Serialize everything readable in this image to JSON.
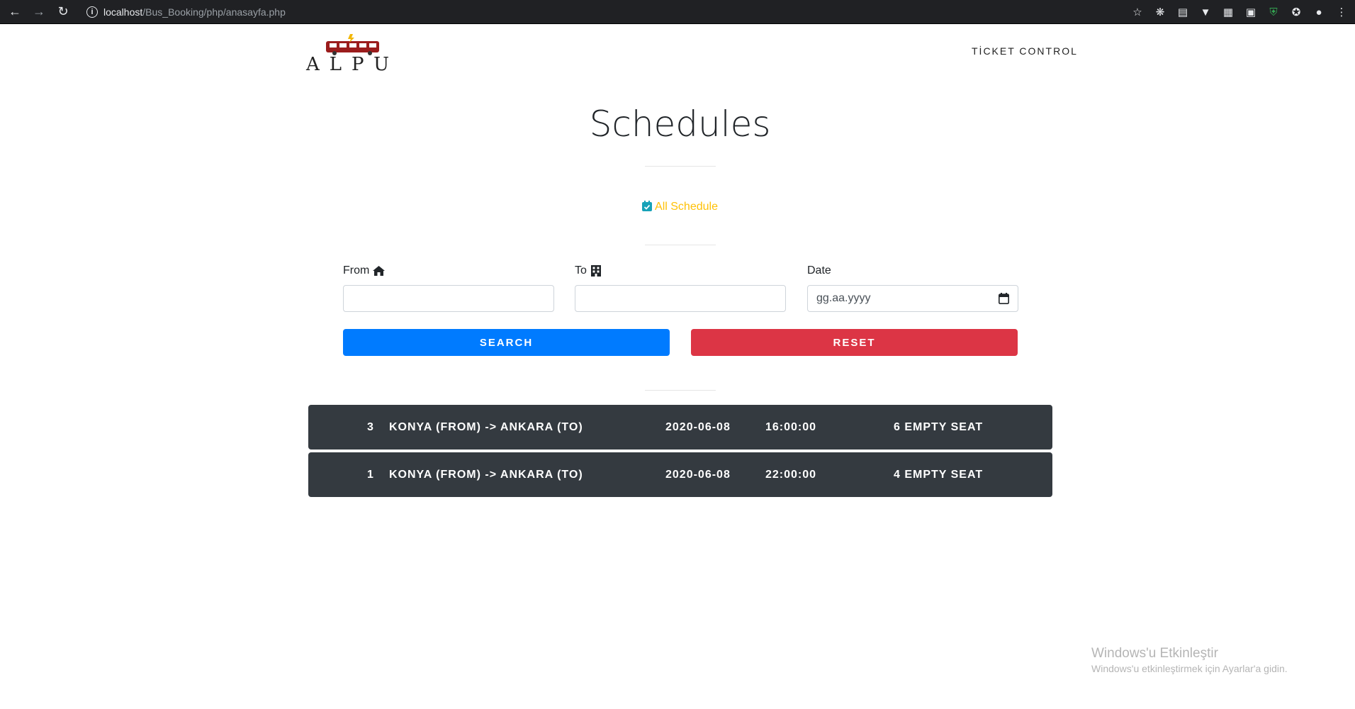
{
  "browser": {
    "url_host": "localhost",
    "url_path": "/Bus_Booking/php/anasayfa.php"
  },
  "navbar": {
    "logo_text": "ALPU",
    "ticket_control": "TİCKET CONTROL"
  },
  "header": {
    "title": "Schedules",
    "all_schedule": "All Schedule"
  },
  "form": {
    "from_label": "From",
    "to_label": "To",
    "date_label": "Date",
    "date_placeholder": "gg.aa.yyyy",
    "search_button": "SEARCH",
    "reset_button": "RESET"
  },
  "schedules": [
    {
      "id": "3",
      "route": "KONYA (FROM) -> ANKARA (TO)",
      "date": "2020-06-08",
      "time": "16:00:00",
      "seats": "6 EMPTY SEAT"
    },
    {
      "id": "1",
      "route": "KONYA (FROM) -> ANKARA (TO)",
      "date": "2020-06-08",
      "time": "22:00:00",
      "seats": "4 EMPTY SEAT"
    }
  ],
  "watermark": {
    "title": "Windows'u Etkinleştir",
    "subtitle": "Windows'u etkinleştirmek için Ayarlar'a gidin."
  },
  "colors": {
    "primary": "#007bff",
    "danger": "#dc3545",
    "warning": "#ffc107",
    "dark": "#343a40",
    "info": "#17a2b8"
  },
  "icons": {
    "from": "home-icon",
    "to": "building-icon",
    "all_schedule": "calendar-check-icon",
    "date_picker": "calendar-icon"
  }
}
